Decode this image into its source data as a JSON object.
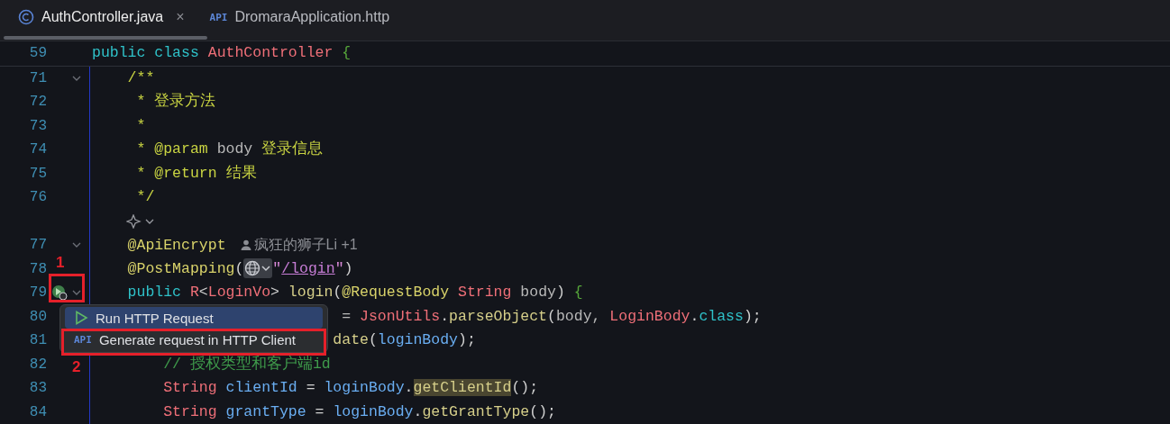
{
  "tabs": [
    {
      "label": "AuthController.java",
      "kind": "class",
      "selected": true,
      "close": "×"
    },
    {
      "label": "DromaraApplication.http",
      "kind": "api",
      "icon_label": "API",
      "selected": false
    }
  ],
  "lines": [
    {
      "kind": "sticky",
      "number": "59",
      "fold": false,
      "tokens": [
        {
          "kind": "kw",
          "text": "public class "
        },
        {
          "kind": "cls",
          "text": "AuthController "
        },
        {
          "kind": "brace",
          "text": "{"
        }
      ]
    },
    {
      "kind": "code",
      "number": "71",
      "fold": true,
      "tokens": [
        {
          "kind": "doc",
          "text": "    /**"
        }
      ]
    },
    {
      "kind": "code",
      "number": "72",
      "fold": false,
      "tokens": [
        {
          "kind": "doc",
          "text": "     * 登录方法"
        }
      ]
    },
    {
      "kind": "code",
      "number": "73",
      "fold": false,
      "tokens": [
        {
          "kind": "doc",
          "text": "     *"
        }
      ]
    },
    {
      "kind": "code",
      "number": "74",
      "fold": false,
      "tokens": [
        {
          "kind": "doc",
          "text": "     * @param "
        },
        {
          "kind": "plain",
          "text": "body "
        },
        {
          "kind": "doc",
          "text": "登录信息"
        }
      ]
    },
    {
      "kind": "code",
      "number": "75",
      "fold": false,
      "tokens": [
        {
          "kind": "doc",
          "text": "     * @return 结果"
        }
      ]
    },
    {
      "kind": "code",
      "number": "76",
      "fold": false,
      "tokens": [
        {
          "kind": "doc",
          "text": "     */"
        }
      ]
    },
    {
      "kind": "lens"
    },
    {
      "kind": "code",
      "number": "77",
      "fold": true,
      "tokens": [
        {
          "kind": "ann",
          "text": "    @ApiEncrypt"
        }
      ],
      "author": "疯狂的狮子Li +1"
    },
    {
      "kind": "code",
      "number": "78",
      "fold": false,
      "tokens": [
        {
          "kind": "ann",
          "text": "    @PostMapping"
        },
        {
          "kind": "punct",
          "text": "("
        },
        {
          "kind": "globe"
        },
        {
          "kind": "str",
          "text": "\""
        },
        {
          "kind": "link",
          "text": "/login"
        },
        {
          "kind": "str",
          "text": "\""
        },
        {
          "kind": "punct",
          "text": ")"
        }
      ]
    },
    {
      "kind": "code",
      "number": "79",
      "fold": true,
      "run_icon": true,
      "tokens": [
        {
          "kind": "kw",
          "text": "    public "
        },
        {
          "kind": "cls",
          "text": "R"
        },
        {
          "kind": "punct",
          "text": "<"
        },
        {
          "kind": "cls",
          "text": "LoginVo"
        },
        {
          "kind": "punct",
          "text": "> "
        },
        {
          "kind": "method",
          "text": "login"
        },
        {
          "kind": "punct",
          "text": "("
        },
        {
          "kind": "ann",
          "text": "@RequestBody "
        },
        {
          "kind": "cls",
          "text": "String "
        },
        {
          "kind": "plain",
          "text": "body"
        },
        {
          "kind": "punct",
          "text": ") "
        },
        {
          "kind": "brace",
          "text": "{"
        }
      ]
    },
    {
      "kind": "code",
      "number": "80",
      "fold": false,
      "tokens": [
        {
          "kind": "plain",
          "text": "                            = "
        },
        {
          "kind": "cls",
          "text": "JsonUtils"
        },
        {
          "kind": "punct",
          "text": "."
        },
        {
          "kind": "method",
          "text": "parseObject"
        },
        {
          "kind": "punct",
          "text": "("
        },
        {
          "kind": "plain",
          "text": "body, "
        },
        {
          "kind": "cls",
          "text": "LoginBody"
        },
        {
          "kind": "punct",
          "text": "."
        },
        {
          "kind": "kw",
          "text": "class"
        },
        {
          "kind": "punct",
          "text": ");"
        }
      ]
    },
    {
      "kind": "code",
      "number": "81",
      "fold": false,
      "tokens": [
        {
          "kind": "method",
          "text": "                           date"
        },
        {
          "kind": "punct",
          "text": "("
        },
        {
          "kind": "ident",
          "text": "loginBody"
        },
        {
          "kind": "punct",
          "text": ");"
        }
      ]
    },
    {
      "kind": "code",
      "number": "82",
      "fold": false,
      "tokens": [
        {
          "kind": "comment",
          "text": "        // 授权类型和客户端id"
        }
      ]
    },
    {
      "kind": "code",
      "number": "83",
      "fold": false,
      "tokens": [
        {
          "kind": "cls",
          "text": "        String "
        },
        {
          "kind": "ident",
          "text": "clientId"
        },
        {
          "kind": "punct",
          "text": " = "
        },
        {
          "kind": "ident",
          "text": "loginBody"
        },
        {
          "kind": "punct",
          "text": "."
        },
        {
          "kind": "hl",
          "text": "getClientId"
        },
        {
          "kind": "punct",
          "text": "();"
        }
      ]
    },
    {
      "kind": "code",
      "number": "84",
      "fold": false,
      "tokens": [
        {
          "kind": "cls",
          "text": "        String "
        },
        {
          "kind": "ident",
          "text": "grantType"
        },
        {
          "kind": "punct",
          "text": " = "
        },
        {
          "kind": "ident",
          "text": "loginBody"
        },
        {
          "kind": "punct",
          "text": "."
        },
        {
          "kind": "method",
          "text": "getGrantType"
        },
        {
          "kind": "punct",
          "text": "();"
        }
      ]
    }
  ],
  "popup": {
    "items": [
      {
        "label": "Run HTTP Request",
        "kind": "run",
        "selected": true
      },
      {
        "label": "Generate request in HTTP Client",
        "kind": "api",
        "icon_label": "API",
        "selected": false
      }
    ]
  },
  "annotations": [
    {
      "label": "1",
      "kind": "gutter"
    },
    {
      "label": "2",
      "kind": "menu"
    }
  ]
}
